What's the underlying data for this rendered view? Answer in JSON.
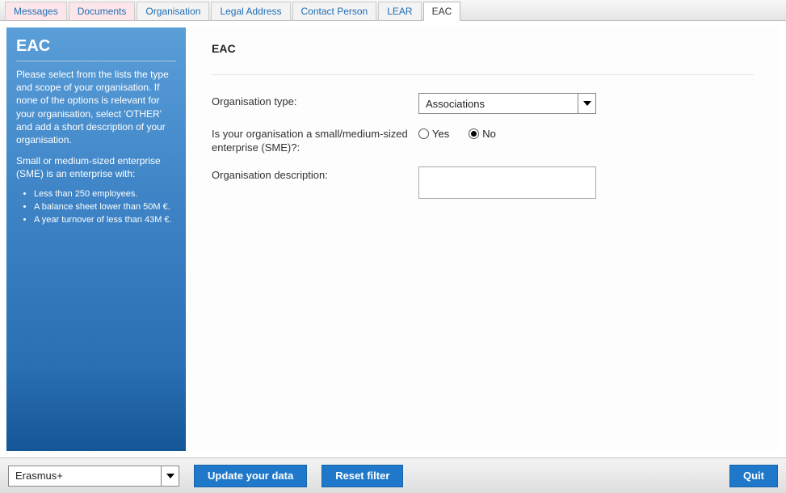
{
  "tabs": [
    {
      "label": "Messages",
      "state": "pink"
    },
    {
      "label": "Documents",
      "state": "pink"
    },
    {
      "label": "Organisation",
      "state": "normal"
    },
    {
      "label": "Legal Address",
      "state": "normal"
    },
    {
      "label": "Contact Person",
      "state": "normal"
    },
    {
      "label": "LEAR",
      "state": "normal"
    },
    {
      "label": "EAC",
      "state": "active"
    }
  ],
  "sidebar": {
    "title": "EAC",
    "para1": "Please select from the lists the type and scope of your organisation. If none of the options is relevant for your organisation, select 'OTHER' and add a short description of your organisation.",
    "para2": "Small or medium-sized enterprise (SME) is an enterprise with:",
    "bullets": [
      "Less than 250 employees.",
      "A balance sheet lower than 50M €.",
      "A year turnover of less than 43M €."
    ]
  },
  "main": {
    "heading": "EAC",
    "labels": {
      "org_type": "Organisation type:",
      "sme": "Is your organisation a small/medium-sized enterprise (SME)?:",
      "desc": "Organisation description:"
    },
    "org_type_value": "Associations",
    "sme_options": {
      "yes": "Yes",
      "no": "No"
    },
    "sme_selected": "no",
    "desc_value": ""
  },
  "footer": {
    "filter_value": "Erasmus+",
    "update_label": "Update your data",
    "reset_label": "Reset filter",
    "quit_label": "Quit"
  }
}
